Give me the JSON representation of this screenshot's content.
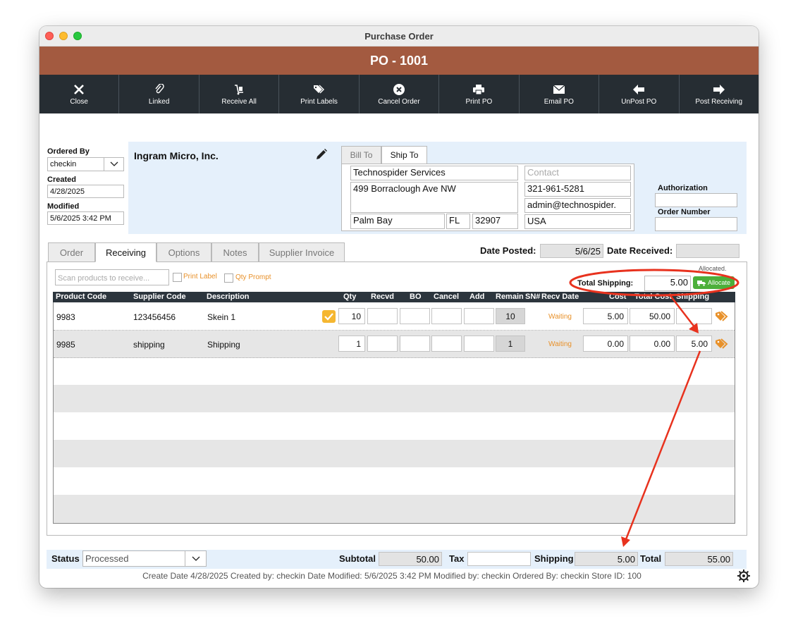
{
  "window": {
    "title": "Purchase Order",
    "po_number": "PO - 1001"
  },
  "toolbar": [
    {
      "label": "Close",
      "icon": "close-icon"
    },
    {
      "label": "Linked",
      "icon": "paperclip-icon"
    },
    {
      "label": "Receive All",
      "icon": "hand-truck-icon"
    },
    {
      "label": "Print Labels",
      "icon": "tags-icon"
    },
    {
      "label": "Cancel Order",
      "icon": "cancel-circle-icon"
    },
    {
      "label": "Print PO",
      "icon": "printer-icon"
    },
    {
      "label": "Email PO",
      "icon": "envelope-icon"
    },
    {
      "label": "UnPost PO",
      "icon": "arrow-left-icon"
    },
    {
      "label": "Post Receiving",
      "icon": "arrow-right-icon"
    }
  ],
  "info": {
    "ordered_by_label": "Ordered By",
    "ordered_by": "checkin",
    "created_label": "Created",
    "created": "4/28/2025",
    "modified_label": "Modified",
    "modified": "5/6/2025 3:42 PM"
  },
  "vendor": {
    "name": "Ingram Micro, Inc."
  },
  "address": {
    "tabs": [
      "Bill To",
      "Ship To"
    ],
    "active_tab": "Ship To",
    "company": "Technospider Services",
    "street": "499 Borraclough Ave NW",
    "city": "Palm Bay",
    "state": "FL",
    "zip": "32907",
    "contact_placeholder": "Contact",
    "phone": "321-961-5281",
    "email": "admin@technospider.",
    "country": "USA"
  },
  "auth": {
    "authorization_label": "Authorization",
    "order_number_label": "Order Number"
  },
  "main_tabs": [
    "Order",
    "Receiving",
    "Options",
    "Notes",
    "Supplier Invoice"
  ],
  "active_main_tab": "Receiving",
  "dates": {
    "posted_label": "Date Posted:",
    "posted": "5/6/25",
    "received_label": "Date Received:"
  },
  "receiving": {
    "scan_placeholder": "Scan products to receive...",
    "print_label": "Print Label",
    "qty_prompt": "Qty Prompt",
    "allocated_note": "Allocated.",
    "total_shipping_label": "Total Shipping:",
    "total_shipping": "5.00",
    "allocate_button": "Allocate"
  },
  "table": {
    "headers": [
      "Product Code",
      "Supplier Code",
      "Description",
      "Qty",
      "Recvd",
      "BO",
      "Cancel",
      "Add",
      "Remain",
      "SN#",
      "Recv Date",
      "Cost",
      "Total Cost",
      "Shipping"
    ],
    "rows": [
      {
        "product_code": "9983",
        "supplier_code": "123456456",
        "description": "Skein 1",
        "qty": "10",
        "remain": "10",
        "recv_date": "Waiting",
        "cost": "5.00",
        "total_cost": "50.00",
        "shipping": ""
      },
      {
        "product_code": "9985",
        "supplier_code": "shipping",
        "description": "Shipping",
        "qty": "1",
        "remain": "1",
        "recv_date": "Waiting",
        "cost": "0.00",
        "total_cost": "0.00",
        "shipping": "5.00"
      }
    ]
  },
  "footer": {
    "status_label": "Status",
    "status": "Processed",
    "subtotal_label": "Subtotal",
    "subtotal": "50.00",
    "tax_label": "Tax",
    "tax": "",
    "shipping_label": "Shipping",
    "shipping": "5.00",
    "total_label": "Total",
    "total": "55.00",
    "status_line": "Create Date 4/28/2025 Created by: checkin Date Modified: 5/6/2025 3:42 PM Modified by: checkin Ordered By: checkin Store ID: 100"
  },
  "colors": {
    "banner": "#a35a40",
    "toolbar": "#262d33",
    "panel": "#e5f0fb",
    "allocate": "#4caf3a",
    "annotation": "#e8321e",
    "waiting": "#e8912a"
  }
}
